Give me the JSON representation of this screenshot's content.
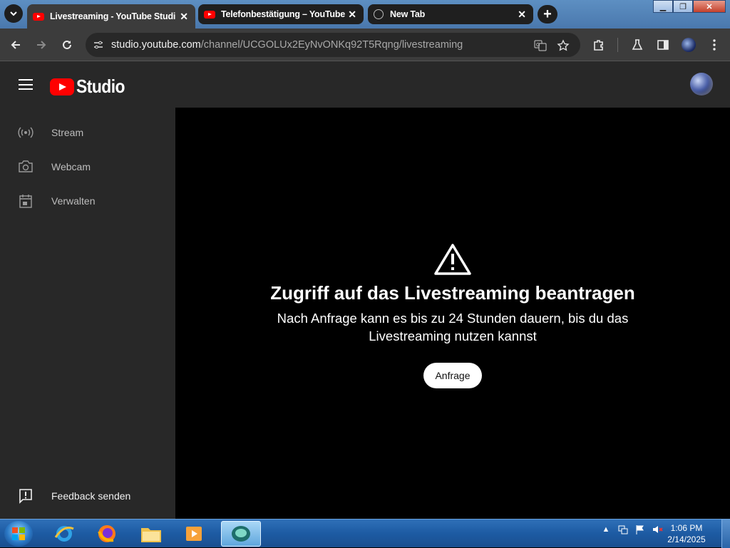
{
  "browser": {
    "tabs": [
      {
        "title": "Livestreaming - YouTube Studi",
        "active": true,
        "favicon": "youtube-icon"
      },
      {
        "title": "Telefonbestätigung – YouTube",
        "active": false,
        "favicon": "youtube-icon"
      },
      {
        "title": "New Tab",
        "active": false,
        "favicon": "globe-icon"
      }
    ],
    "url": {
      "host": "studio.youtube.com",
      "path": "/channel/UCGOLUx2EyNvONKq92T5Rqng/livestreaming"
    }
  },
  "app": {
    "logo_text": "Studio",
    "sidebar": {
      "items": [
        {
          "label": "Stream",
          "icon": "broadcast-icon"
        },
        {
          "label": "Webcam",
          "icon": "camera-icon"
        },
        {
          "label": "Verwalten",
          "icon": "calendar-icon"
        }
      ],
      "feedback": "Feedback senden"
    },
    "main": {
      "heading": "Zugriff auf das Livestreaming beantragen",
      "description": "Nach Anfrage kann es bis zu 24 Stunden dauern, bis du das Livestreaming nutzen kannst",
      "request_button": "Anfrage"
    }
  },
  "taskbar": {
    "time": "1:06 PM",
    "date": "2/14/2025"
  },
  "colors": {
    "youtube_red": "#ff0000",
    "sidebar_bg": "#282828",
    "main_bg": "#000000",
    "taskbar_blue": "#1d5ba3"
  }
}
